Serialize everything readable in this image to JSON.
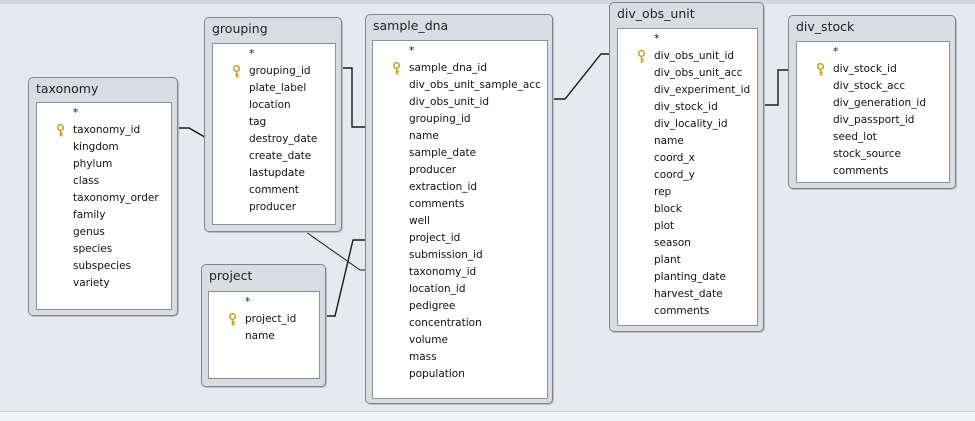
{
  "tables": [
    {
      "id": "taxonomy",
      "title": "taxonomy",
      "fields": [
        {
          "name": "*"
        },
        {
          "name": "taxonomy_id",
          "key": true
        },
        {
          "name": "kingdom"
        },
        {
          "name": "phylum"
        },
        {
          "name": "class"
        },
        {
          "name": "taxonomy_order"
        },
        {
          "name": "family"
        },
        {
          "name": "genus"
        },
        {
          "name": "species"
        },
        {
          "name": "subspecies"
        },
        {
          "name": "variety"
        }
      ]
    },
    {
      "id": "grouping",
      "title": "grouping",
      "fields": [
        {
          "name": "*"
        },
        {
          "name": "grouping_id",
          "key": true
        },
        {
          "name": "plate_label"
        },
        {
          "name": "location"
        },
        {
          "name": "tag"
        },
        {
          "name": "destroy_date"
        },
        {
          "name": "create_date"
        },
        {
          "name": "lastupdate"
        },
        {
          "name": "comment"
        },
        {
          "name": "producer"
        }
      ]
    },
    {
      "id": "project",
      "title": "project",
      "fields": [
        {
          "name": "*"
        },
        {
          "name": "project_id",
          "key": true
        },
        {
          "name": "name"
        }
      ]
    },
    {
      "id": "sample_dna",
      "title": "sample_dna",
      "fields": [
        {
          "name": "*"
        },
        {
          "name": "sample_dna_id",
          "key": true
        },
        {
          "name": "div_obs_unit_sample_acc"
        },
        {
          "name": "div_obs_unit_id"
        },
        {
          "name": "grouping_id"
        },
        {
          "name": "name"
        },
        {
          "name": "sample_date"
        },
        {
          "name": "producer"
        },
        {
          "name": "extraction_id"
        },
        {
          "name": "comments"
        },
        {
          "name": "well"
        },
        {
          "name": "project_id"
        },
        {
          "name": "submission_id"
        },
        {
          "name": "taxonomy_id"
        },
        {
          "name": "location_id"
        },
        {
          "name": "pedigree"
        },
        {
          "name": "concentration"
        },
        {
          "name": "volume"
        },
        {
          "name": "mass"
        },
        {
          "name": "population"
        }
      ]
    },
    {
      "id": "div_obs_unit",
      "title": "div_obs_unit",
      "fields": [
        {
          "name": "*"
        },
        {
          "name": "div_obs_unit_id",
          "key": true
        },
        {
          "name": "div_obs_unit_acc"
        },
        {
          "name": "div_experiment_id"
        },
        {
          "name": "div_stock_id"
        },
        {
          "name": "div_locality_id"
        },
        {
          "name": "name"
        },
        {
          "name": "coord_x"
        },
        {
          "name": "coord_y"
        },
        {
          "name": "rep"
        },
        {
          "name": "block"
        },
        {
          "name": "plot"
        },
        {
          "name": "season"
        },
        {
          "name": "plant"
        },
        {
          "name": "planting_date"
        },
        {
          "name": "harvest_date"
        },
        {
          "name": "comments"
        }
      ]
    },
    {
      "id": "div_stock",
      "title": "div_stock",
      "fields": [
        {
          "name": "*"
        },
        {
          "name": "div_stock_id",
          "key": true
        },
        {
          "name": "div_stock_acc"
        },
        {
          "name": "div_generation_id"
        },
        {
          "name": "div_passport_id"
        },
        {
          "name": "seed_lot"
        },
        {
          "name": "stock_source"
        },
        {
          "name": "comments"
        }
      ]
    }
  ],
  "relationships": [
    {
      "from_table": "taxonomy",
      "from_field": "taxonomy_id",
      "to_table": "sample_dna",
      "to_field": "taxonomy_id"
    },
    {
      "from_table": "grouping",
      "from_field": "grouping_id",
      "to_table": "sample_dna",
      "to_field": "grouping_id"
    },
    {
      "from_table": "project",
      "from_field": "project_id",
      "to_table": "sample_dna",
      "to_field": "project_id"
    },
    {
      "from_table": "div_obs_unit",
      "from_field": "div_obs_unit_id",
      "to_table": "sample_dna",
      "to_field": "div_obs_unit_id"
    },
    {
      "from_table": "div_stock",
      "from_field": "div_stock_id",
      "to_table": "div_obs_unit",
      "to_field": "div_stock_id"
    }
  ],
  "colors": {
    "key_icon": "#c9a227",
    "line": "#1a1a1a"
  }
}
